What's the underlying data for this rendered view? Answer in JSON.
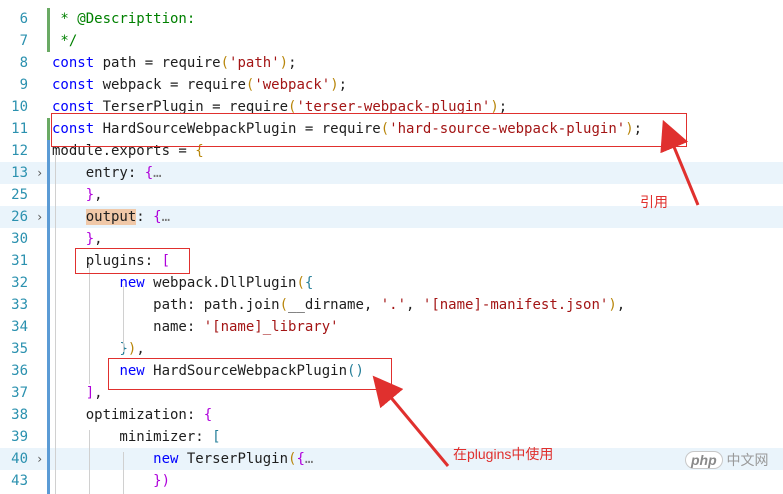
{
  "editor": {
    "lines": [
      {
        "num": "6",
        "fold": false,
        "highlight": false,
        "segments": [
          {
            "t": " * @Descripttion:",
            "c": "c"
          }
        ]
      },
      {
        "num": "7",
        "fold": false,
        "highlight": false,
        "segments": [
          {
            "t": " */",
            "c": "c"
          }
        ]
      },
      {
        "num": "8",
        "fold": false,
        "highlight": false,
        "segments": [
          {
            "t": "const ",
            "c": "k"
          },
          {
            "t": "path = ",
            "c": "p"
          },
          {
            "t": "require",
            "c": "p"
          },
          {
            "t": "(",
            "c": "y"
          },
          {
            "t": "'path'",
            "c": "s"
          },
          {
            "t": ")",
            "c": "y"
          },
          {
            "t": ";",
            "c": "p"
          }
        ]
      },
      {
        "num": "9",
        "fold": false,
        "highlight": false,
        "segments": [
          {
            "t": "const ",
            "c": "k"
          },
          {
            "t": "webpack = ",
            "c": "p"
          },
          {
            "t": "require",
            "c": "p"
          },
          {
            "t": "(",
            "c": "y"
          },
          {
            "t": "'webpack'",
            "c": "s"
          },
          {
            "t": ")",
            "c": "y"
          },
          {
            "t": ";",
            "c": "p"
          }
        ]
      },
      {
        "num": "10",
        "fold": false,
        "highlight": false,
        "segments": [
          {
            "t": "const ",
            "c": "k"
          },
          {
            "t": "TerserPlugin = ",
            "c": "p"
          },
          {
            "t": "require",
            "c": "p"
          },
          {
            "t": "(",
            "c": "y"
          },
          {
            "t": "'terser-webpack-plugin'",
            "c": "s"
          },
          {
            "t": ")",
            "c": "y"
          },
          {
            "t": ";",
            "c": "p"
          }
        ]
      },
      {
        "num": "11",
        "fold": false,
        "highlight": false,
        "segments": [
          {
            "t": "const ",
            "c": "k"
          },
          {
            "t": "HardSourceWebpackPlugin = ",
            "c": "p"
          },
          {
            "t": "require",
            "c": "p"
          },
          {
            "t": "(",
            "c": "y"
          },
          {
            "t": "'hard-source-webpack-plugin'",
            "c": "s"
          },
          {
            "t": ")",
            "c": "y"
          },
          {
            "t": ";",
            "c": "p"
          }
        ]
      },
      {
        "num": "12",
        "fold": false,
        "highlight": false,
        "segments": [
          {
            "t": "module",
            "c": "p"
          },
          {
            "t": ".exports = ",
            "c": "p"
          },
          {
            "t": "{",
            "c": "y"
          }
        ]
      },
      {
        "num": "13",
        "fold": true,
        "highlight": true,
        "segments": [
          {
            "t": "    entry: ",
            "c": "p"
          },
          {
            "t": "{",
            "c": "m"
          },
          {
            "t": "…",
            "c": "e"
          }
        ]
      },
      {
        "num": "25",
        "fold": false,
        "highlight": false,
        "segments": [
          {
            "t": "    ",
            "c": "p"
          },
          {
            "t": "}",
            "c": "m"
          },
          {
            "t": ",",
            "c": "p"
          }
        ]
      },
      {
        "num": "26",
        "fold": true,
        "highlight": true,
        "segments": [
          {
            "t": "    ",
            "c": "p"
          },
          {
            "t": "output",
            "c": "outputhl"
          },
          {
            "t": ": ",
            "c": "p"
          },
          {
            "t": "{",
            "c": "m"
          },
          {
            "t": "…",
            "c": "e"
          }
        ]
      },
      {
        "num": "30",
        "fold": false,
        "highlight": false,
        "segments": [
          {
            "t": "    ",
            "c": "p"
          },
          {
            "t": "}",
            "c": "m"
          },
          {
            "t": ",",
            "c": "p"
          }
        ]
      },
      {
        "num": "31",
        "fold": false,
        "highlight": false,
        "segments": [
          {
            "t": "    plugins: ",
            "c": "p"
          },
          {
            "t": "[",
            "c": "m"
          }
        ]
      },
      {
        "num": "32",
        "fold": false,
        "highlight": false,
        "segments": [
          {
            "t": "        ",
            "c": "p"
          },
          {
            "t": "new ",
            "c": "k"
          },
          {
            "t": "webpack.DllPlugin",
            "c": "p"
          },
          {
            "t": "(",
            "c": "y"
          },
          {
            "t": "{",
            "c": "b"
          }
        ]
      },
      {
        "num": "33",
        "fold": false,
        "highlight": false,
        "segments": [
          {
            "t": "            path: path.join",
            "c": "p"
          },
          {
            "t": "(",
            "c": "y"
          },
          {
            "t": "__dirname, ",
            "c": "p"
          },
          {
            "t": "'.'",
            "c": "s"
          },
          {
            "t": ", ",
            "c": "p"
          },
          {
            "t": "'[name]-manifest.json'",
            "c": "s"
          },
          {
            "t": ")",
            "c": "y"
          },
          {
            "t": ",",
            "c": "p"
          }
        ]
      },
      {
        "num": "34",
        "fold": false,
        "highlight": false,
        "segments": [
          {
            "t": "            name: ",
            "c": "p"
          },
          {
            "t": "'[name]_library'",
            "c": "s"
          }
        ]
      },
      {
        "num": "35",
        "fold": false,
        "highlight": false,
        "segments": [
          {
            "t": "        ",
            "c": "p"
          },
          {
            "t": "}",
            "c": "b"
          },
          {
            "t": ")",
            "c": "y"
          },
          {
            "t": ",",
            "c": "p"
          }
        ]
      },
      {
        "num": "36",
        "fold": false,
        "highlight": false,
        "segments": [
          {
            "t": "        ",
            "c": "p"
          },
          {
            "t": "new ",
            "c": "k"
          },
          {
            "t": "HardSourceWebpackPlugin",
            "c": "p"
          },
          {
            "t": "()",
            "c": "b"
          }
        ]
      },
      {
        "num": "37",
        "fold": false,
        "highlight": false,
        "segments": [
          {
            "t": "    ",
            "c": "p"
          },
          {
            "t": "]",
            "c": "m"
          },
          {
            "t": ",",
            "c": "p"
          }
        ]
      },
      {
        "num": "38",
        "fold": false,
        "highlight": false,
        "segments": [
          {
            "t": "    optimization: ",
            "c": "p"
          },
          {
            "t": "{",
            "c": "m"
          }
        ]
      },
      {
        "num": "39",
        "fold": false,
        "highlight": false,
        "segments": [
          {
            "t": "        minimizer: ",
            "c": "p"
          },
          {
            "t": "[",
            "c": "b"
          }
        ]
      },
      {
        "num": "40",
        "fold": true,
        "highlight": true,
        "segments": [
          {
            "t": "            ",
            "c": "p"
          },
          {
            "t": "new ",
            "c": "k"
          },
          {
            "t": "TerserPlugin",
            "c": "p"
          },
          {
            "t": "(",
            "c": "y"
          },
          {
            "t": "{",
            "c": "m"
          },
          {
            "t": "…",
            "c": "e"
          }
        ]
      },
      {
        "num": "43",
        "fold": false,
        "highlight": false,
        "segments": [
          {
            "t": "            ",
            "c": "p"
          },
          {
            "t": "})",
            "c": "m"
          }
        ]
      }
    ]
  },
  "annotations": {
    "cite": "引用",
    "use_in_plugins": "在plugins中使用"
  },
  "watermark": {
    "logo": "php",
    "text": "中文网"
  },
  "colors": {
    "annotation": "#e0302e",
    "line_highlight": "#eaf4fb"
  }
}
